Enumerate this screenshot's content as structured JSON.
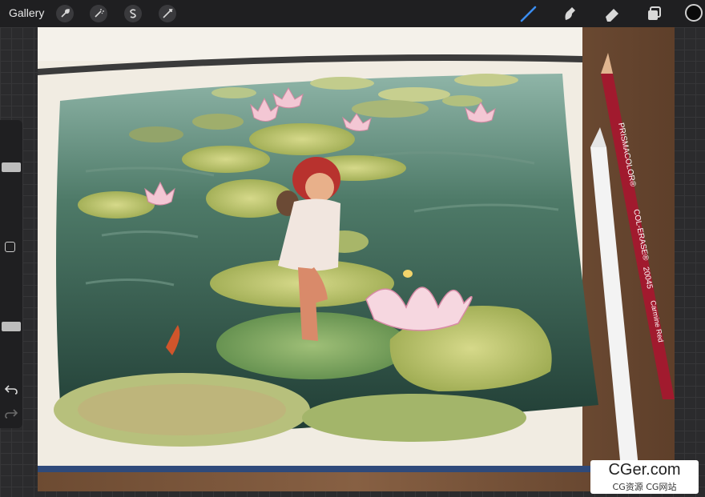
{
  "topbar": {
    "gallery_label": "Gallery",
    "left_tools": [
      {
        "icon": "wrench-icon"
      },
      {
        "icon": "magic-wand-icon"
      },
      {
        "icon": "selection-s-icon"
      },
      {
        "icon": "transform-arrow-icon"
      }
    ],
    "right_tools": [
      {
        "icon": "brush-icon",
        "active": true
      },
      {
        "icon": "smudge-icon"
      },
      {
        "icon": "eraser-icon"
      },
      {
        "icon": "layers-icon"
      }
    ],
    "current_color": "#0a0a0a",
    "accent_color": "#3b8df0"
  },
  "sidebar": {
    "brush_size_level": 0.55,
    "opacity_level": 0.35,
    "undo_icon": "undo-icon",
    "redo_icon": "redo-icon"
  },
  "artwork": {
    "pencil_brand": "PRISMACOLOR®",
    "pencil_line": "COL-ERASE®",
    "pencil_code": "20045",
    "pencil_color_name": "Carmine Red"
  },
  "watermark": {
    "title": "CGer.com",
    "subtitle": "CG资源 CG网站"
  }
}
